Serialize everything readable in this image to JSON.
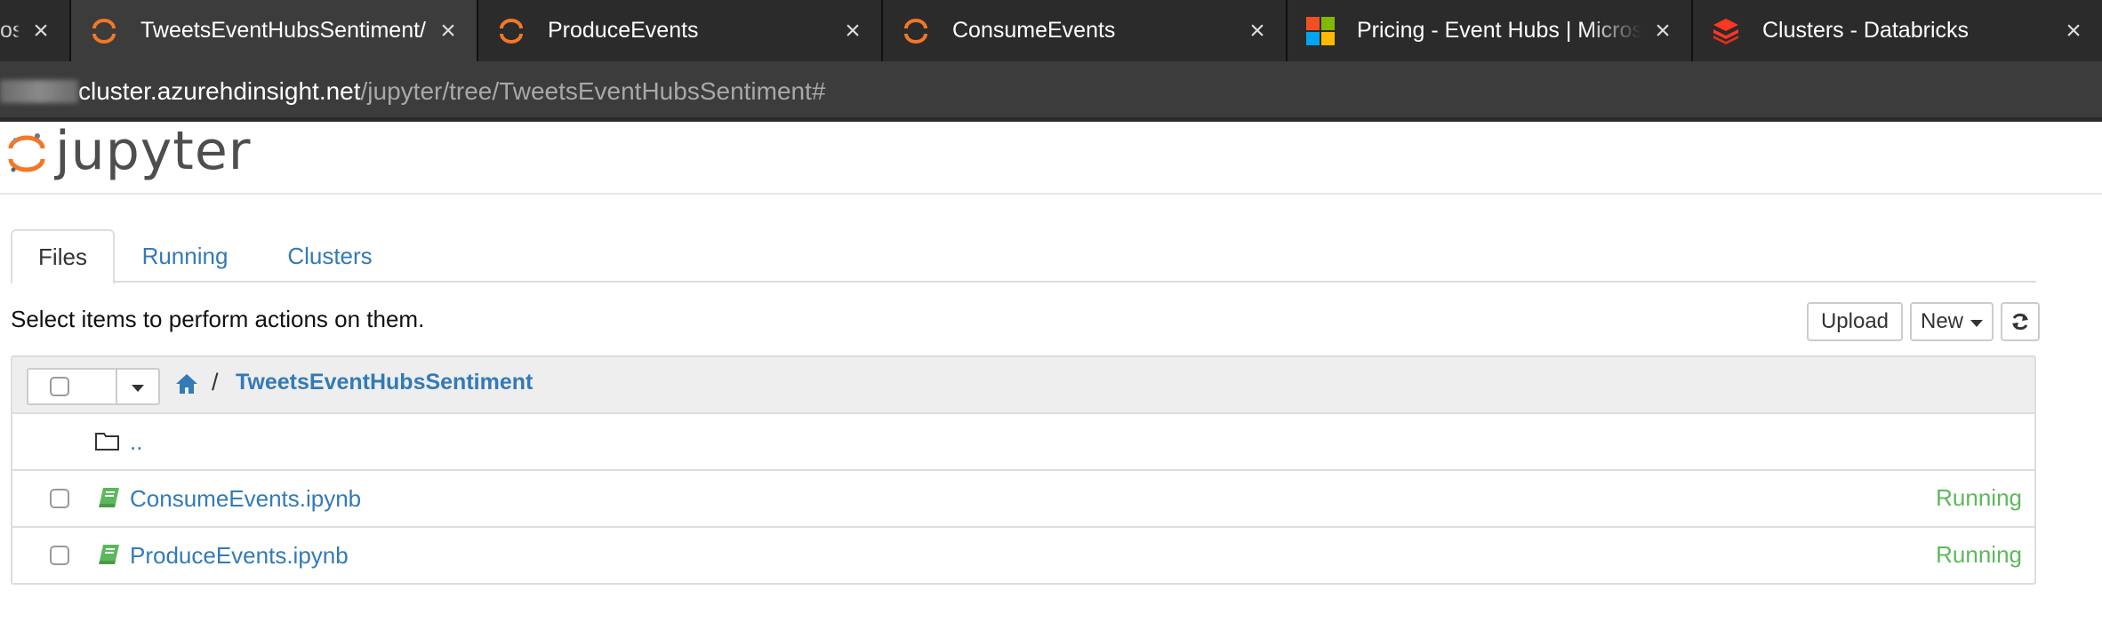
{
  "browser": {
    "tabs": [
      {
        "label": "oso",
        "favicon": "microsoft-icon",
        "active": false
      },
      {
        "label": "TweetsEventHubsSentiment/",
        "favicon": "jupyter-icon",
        "active": true
      },
      {
        "label": "ProduceEvents",
        "favicon": "jupyter-icon",
        "active": false
      },
      {
        "label": "ConsumeEvents",
        "favicon": "jupyter-icon",
        "active": false
      },
      {
        "label": "Pricing - Event Hubs | Microso",
        "favicon": "microsoft-icon",
        "active": false
      },
      {
        "label": "Clusters - Databricks",
        "favicon": "databricks-icon",
        "active": false
      }
    ],
    "close_glyph": "×",
    "address": {
      "host": "cluster.azurehdinsight.net",
      "path": "/jupyter/tree/TweetsEventHubsSentiment#"
    }
  },
  "jupyter": {
    "logo_text": "jupyter",
    "tabs": [
      {
        "label": "Files",
        "active": true
      },
      {
        "label": "Running",
        "active": false
      },
      {
        "label": "Clusters",
        "active": false
      }
    ],
    "hint": "Select items to perform actions on them.",
    "buttons": {
      "upload": "Upload",
      "new": "New"
    },
    "breadcrumb": {
      "separator": "/",
      "folder": "TweetsEventHubsSentiment"
    },
    "items": [
      {
        "name": "..",
        "type": "parent-folder",
        "status": ""
      },
      {
        "name": "ConsumeEvents.ipynb",
        "type": "notebook",
        "status": "Running"
      },
      {
        "name": "ProduceEvents.ipynb",
        "type": "notebook",
        "status": "Running"
      }
    ]
  },
  "colors": {
    "link": "#337ab7",
    "running": "#5cb85c",
    "jupyter_orange": "#f37726"
  }
}
